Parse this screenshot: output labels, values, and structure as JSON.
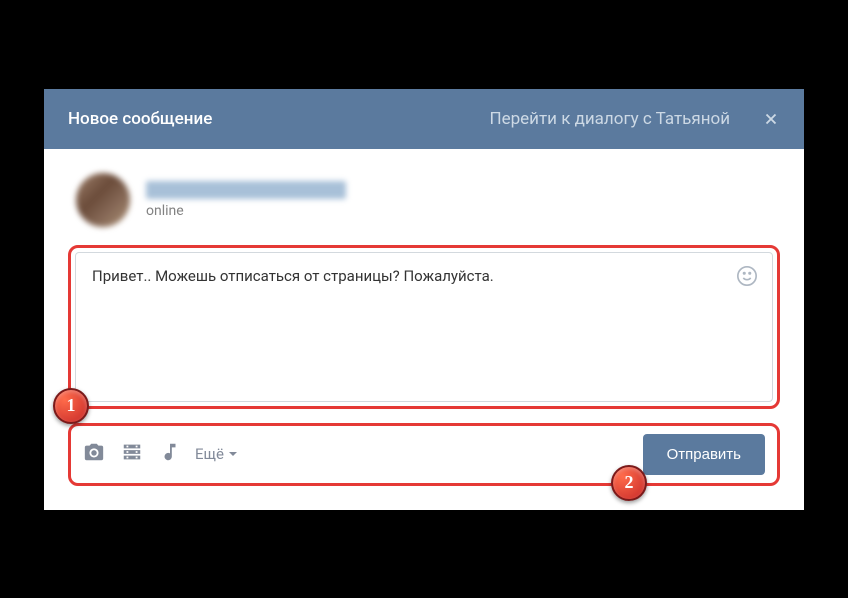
{
  "header": {
    "title": "Новое сообщение",
    "dialog_link": "Перейти к диалогу с Татьяной"
  },
  "user": {
    "status": "online"
  },
  "compose": {
    "message_text": "Привет.. Можешь отписаться от страницы? Пожалуйста."
  },
  "footer": {
    "more_label": "Ещё",
    "send_label": "Отправить"
  },
  "annotations": {
    "badge1": "1",
    "badge2": "2"
  }
}
